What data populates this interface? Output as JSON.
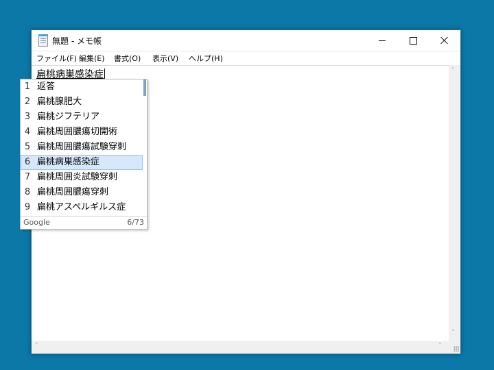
{
  "window": {
    "title": "無題 - メモ帳",
    "controls": [
      "minimize",
      "maximize",
      "close"
    ]
  },
  "menu": [
    "ファイル(F)",
    "編集(E)",
    "書式(O)",
    "表示(V)",
    "ヘルプ(H)"
  ],
  "editor": {
    "text": "扁桃病巣感染症"
  },
  "ime": {
    "candidates": [
      {
        "num": "1",
        "text": "返答"
      },
      {
        "num": "2",
        "text": "扁桃腺肥大"
      },
      {
        "num": "3",
        "text": "扁桃ジフテリア"
      },
      {
        "num": "4",
        "text": "扁桃周囲膿瘍切開術"
      },
      {
        "num": "5",
        "text": "扁桃周囲膿瘍試験穿刺"
      },
      {
        "num": "6",
        "text": "扁桃病巣感染症"
      },
      {
        "num": "7",
        "text": "扁桃周囲炎試験穿刺"
      },
      {
        "num": "8",
        "text": "扁桃周囲膿瘍穿刺"
      },
      {
        "num": "9",
        "text": "扁桃アスペルギルス症"
      }
    ],
    "selected_index": 5,
    "brand": "Google",
    "count": "6/73"
  },
  "colors": {
    "desktop": "#0b78a8",
    "selection": "#d7e8fa"
  },
  "icons": [
    "notepad-icon",
    "minimize-icon",
    "maximize-icon",
    "close-icon",
    "scroll-up-icon",
    "scroll-down-icon",
    "scroll-left-icon",
    "scroll-right-icon",
    "resize-grip-icon"
  ]
}
